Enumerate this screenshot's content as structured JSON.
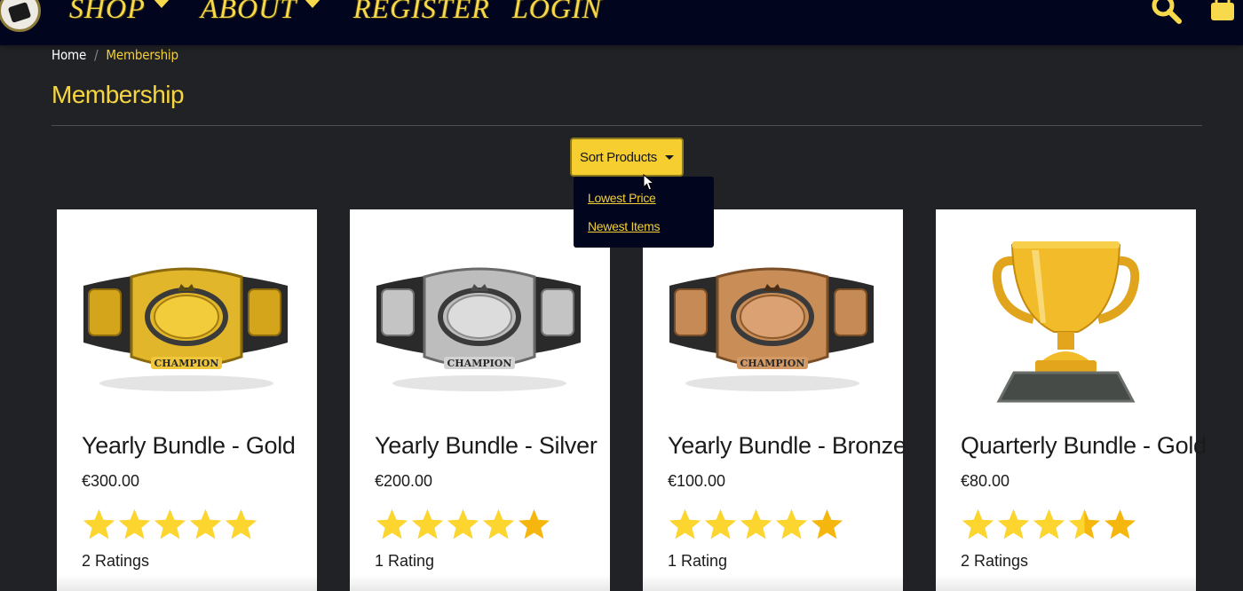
{
  "nav": {
    "items": [
      {
        "label": "SHOP",
        "has_caret": true
      },
      {
        "label": "ABOUT",
        "has_caret": true
      },
      {
        "label": "REGISTER",
        "has_caret": false
      },
      {
        "label": "LOGIN",
        "has_caret": false
      }
    ],
    "icons": [
      "logo",
      "search-icon",
      "shopping-bag-icon"
    ]
  },
  "breadcrumb": {
    "home": "Home",
    "separator": "/",
    "current": "Membership"
  },
  "page_title": "Membership",
  "sort": {
    "button_label": "Sort Products",
    "options": [
      "Lowest Price",
      "Newest Items"
    ]
  },
  "products": [
    {
      "name": "Yearly Bundle - Gold",
      "price": "€300.00",
      "rating": 5,
      "ratings_text": "2 Ratings",
      "image": "gold-belt"
    },
    {
      "name": "Yearly Bundle - Silver",
      "price": "€200.00",
      "rating": 4,
      "ratings_text": "1 Rating",
      "image": "silver-belt"
    },
    {
      "name": "Yearly Bundle - Bronze",
      "price": "€100.00",
      "rating": 4,
      "ratings_text": "1 Rating",
      "image": "bronze-belt"
    },
    {
      "name": "Quarterly Bundle - Gold",
      "price": "€80.00",
      "rating": 3.5,
      "ratings_text": "2 Ratings",
      "image": "trophy"
    }
  ],
  "colors": {
    "background": "#212226",
    "topbar": "#01061e",
    "accent": "#f3cf38",
    "star_filled": "#fcd52f",
    "star_empty": "#f5b60d"
  }
}
